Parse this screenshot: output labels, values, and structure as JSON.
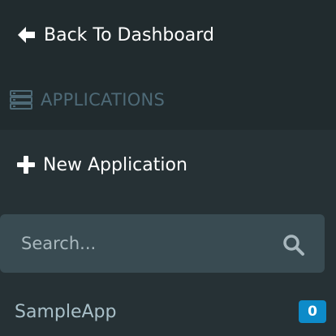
{
  "nav": {
    "back_label": "Back To Dashboard",
    "back_icon": "arrow-left-icon"
  },
  "section": {
    "title": "APPLICATIONS",
    "icon": "server-list-icon"
  },
  "actions": {
    "new_app_label": "New Application",
    "new_app_icon": "plus-icon"
  },
  "search": {
    "placeholder": "Search...",
    "value": "",
    "icon": "search-icon"
  },
  "applications": [
    {
      "name": "SampleApp",
      "count": "0"
    }
  ],
  "colors": {
    "background": "#263135",
    "header_background": "#212b2e",
    "search_background": "#394b52",
    "section_text": "#4e6a77",
    "badge": "#0d8bc9"
  }
}
